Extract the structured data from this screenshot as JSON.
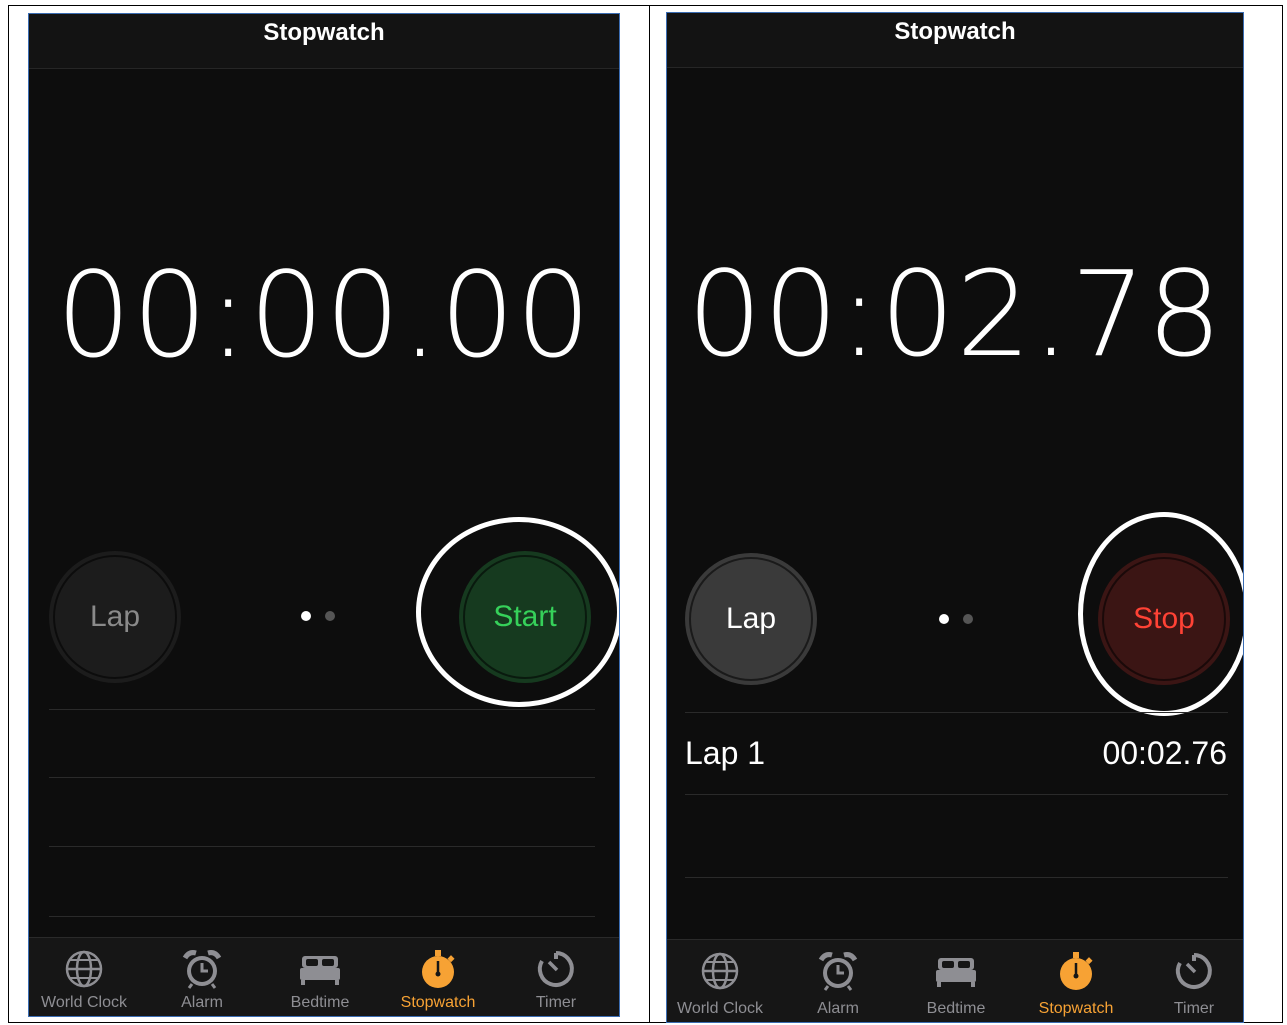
{
  "screens": [
    {
      "nav_title": "Stopwatch",
      "time_display": "00:00.00",
      "lap_button": "Lap",
      "primary_button": "Start",
      "primary_state": "start",
      "page_indicator": {
        "total": 2,
        "current": 1
      },
      "laps": []
    },
    {
      "nav_title": "Stopwatch",
      "time_display": "00:02.78",
      "lap_button": "Lap",
      "primary_button": "Stop",
      "primary_state": "stop",
      "page_indicator": {
        "total": 2,
        "current": 1
      },
      "laps": [
        {
          "label": "Lap 1",
          "time": "00:02.76"
        }
      ]
    }
  ],
  "tabs": [
    {
      "label": "World Clock",
      "icon": "globe-icon"
    },
    {
      "label": "Alarm",
      "icon": "alarm-clock-icon"
    },
    {
      "label": "Bedtime",
      "icon": "bed-icon"
    },
    {
      "label": "Stopwatch",
      "icon": "stopwatch-icon",
      "active": true
    },
    {
      "label": "Timer",
      "icon": "timer-icon"
    }
  ],
  "colors": {
    "background": "#0d0d0d",
    "accent_tab": "#f7a234",
    "start_green": "#36d15a",
    "stop_red": "#ff4235",
    "highlight_ring": "#ffffff"
  }
}
